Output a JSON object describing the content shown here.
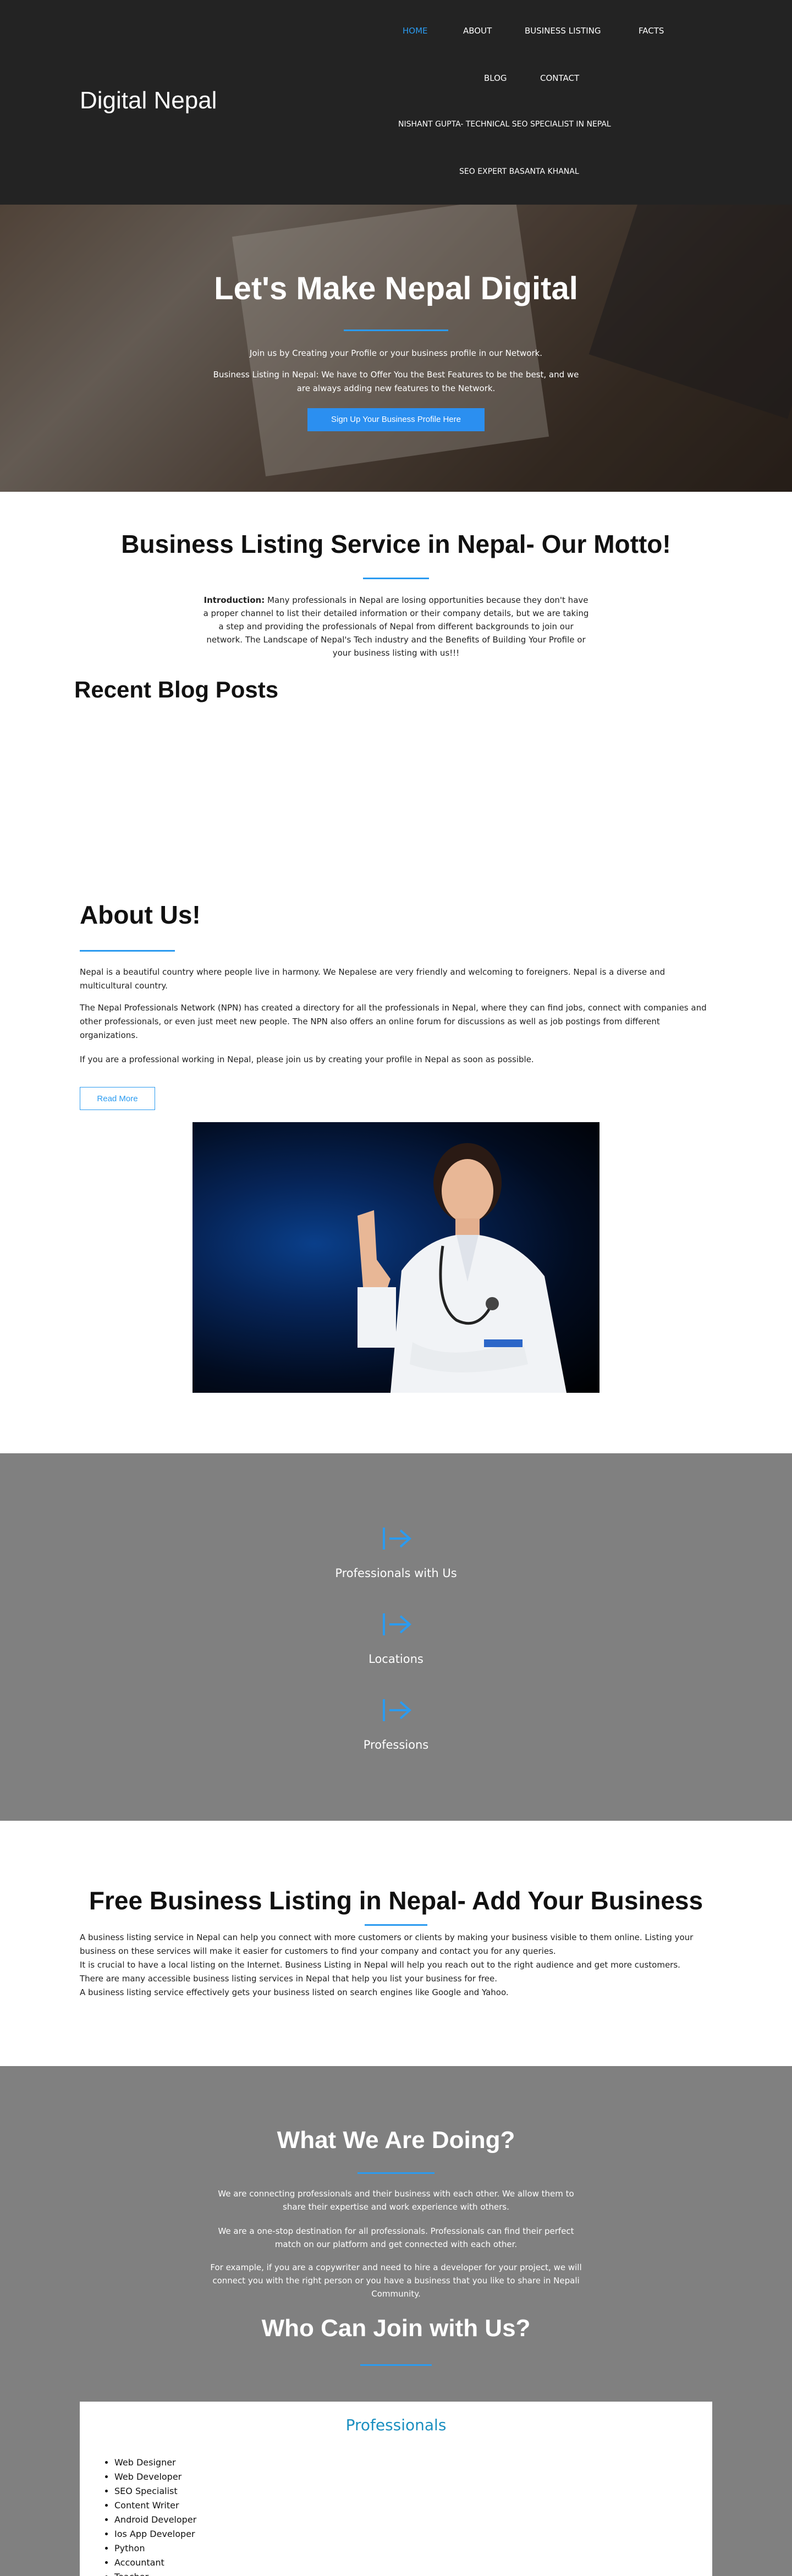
{
  "site": {
    "logo": "Digital Nepal"
  },
  "nav": {
    "home": "HOME",
    "about": "ABOUT",
    "business_listing": "BUSINESS LISTING",
    "facts": "FACTS",
    "blog": "BLOG",
    "contact": "CONTACT",
    "nishant": "NISHANT GUPTA- TECHNICAL SEO SPECIALIST IN NEPAL",
    "seo_expert": "SEO EXPERT BASANTA KHANAL"
  },
  "hero": {
    "title": "Let's Make Nepal Digital",
    "line1": "Join us by Creating your Profile or your business profile in our Network.",
    "line2": "Business Listing in Nepal: We have to Offer You the Best Features to be the best, and we are always adding new features to the Network.",
    "button": "Sign Up Your Business Profile Here"
  },
  "motto": {
    "title": "Business Listing Service in Nepal- Our Motto!",
    "intro_label": "Introduction:",
    "intro_text": " Many professionals in Nepal are losing opportunities because they don't have a proper channel to list their detailed information or their company details, but we are taking a step and providing the professionals of Nepal from different backgrounds to join our network. The Landscape of Nepal's Tech industry and the Benefits of Building Your Profile or your business listing with us!!!"
  },
  "blog": {
    "title": "Recent Blog Posts"
  },
  "about": {
    "title": "About Us!",
    "p1": "Nepal is a beautiful country where people live in harmony. We Nepalese are very friendly and welcoming to foreigners. Nepal is a diverse and multicultural country.",
    "p2": "The Nepal Professionals Network (NPN) has created a directory for all the professionals in Nepal, where they can find jobs, connect with companies and other professionals, or even just meet new people. The NPN also offers an online forum for discussions as well as job postings from different organizations.",
    "p3": "If you are a professional working in Nepal, please join us by creating your profile in Nepal as soon as possible.",
    "read_more": "Read More"
  },
  "stats": {
    "icon": "sign-in-icon",
    "items": [
      "Professionals with Us",
      "Locations",
      "Professions"
    ]
  },
  "free": {
    "title": "Free Business Listing in Nepal- Add Your Business",
    "p1": "A business listing service in Nepal can help you connect with more customers or clients by making your business visible to them online. Listing your business on these services will make it easier for customers to find your company and contact you for any queries.",
    "p2": "It is crucial to have a local listing on the Internet. Business Listing in Nepal will help you reach out to the right audience and get more customers.",
    "p3": "There are many accessible business listing services in Nepal that help you list your business for free.",
    "p4": "A business listing service effectively gets your business listed on search engines like Google and Yahoo."
  },
  "doing": {
    "title": "What We Are Doing?",
    "p1": "We are connecting professionals and their business with each other. We allow them to share their expertise and work experience with others.",
    "p2": "We are a one-stop destination for all professionals. Professionals can find their perfect match on our platform and get connected with each other.",
    "p3": "For example, if you are a copywriter and need to hire a developer for your project, we will connect you with the right person or you have a business that you like to share in Nepali Community."
  },
  "join": {
    "title": "Who Can Join with Us?",
    "card_title": "Professionals",
    "list": [
      "Web Designer",
      "Web Developer",
      "SEO Specialist",
      "Content Writer",
      "Android Developer",
      "Ios App Developer",
      "Python",
      "Accountant",
      "Teacher"
    ]
  },
  "colors": {
    "accent": "#2b9bf0",
    "header_bg": "#232323",
    "gray_section": "#808080"
  }
}
